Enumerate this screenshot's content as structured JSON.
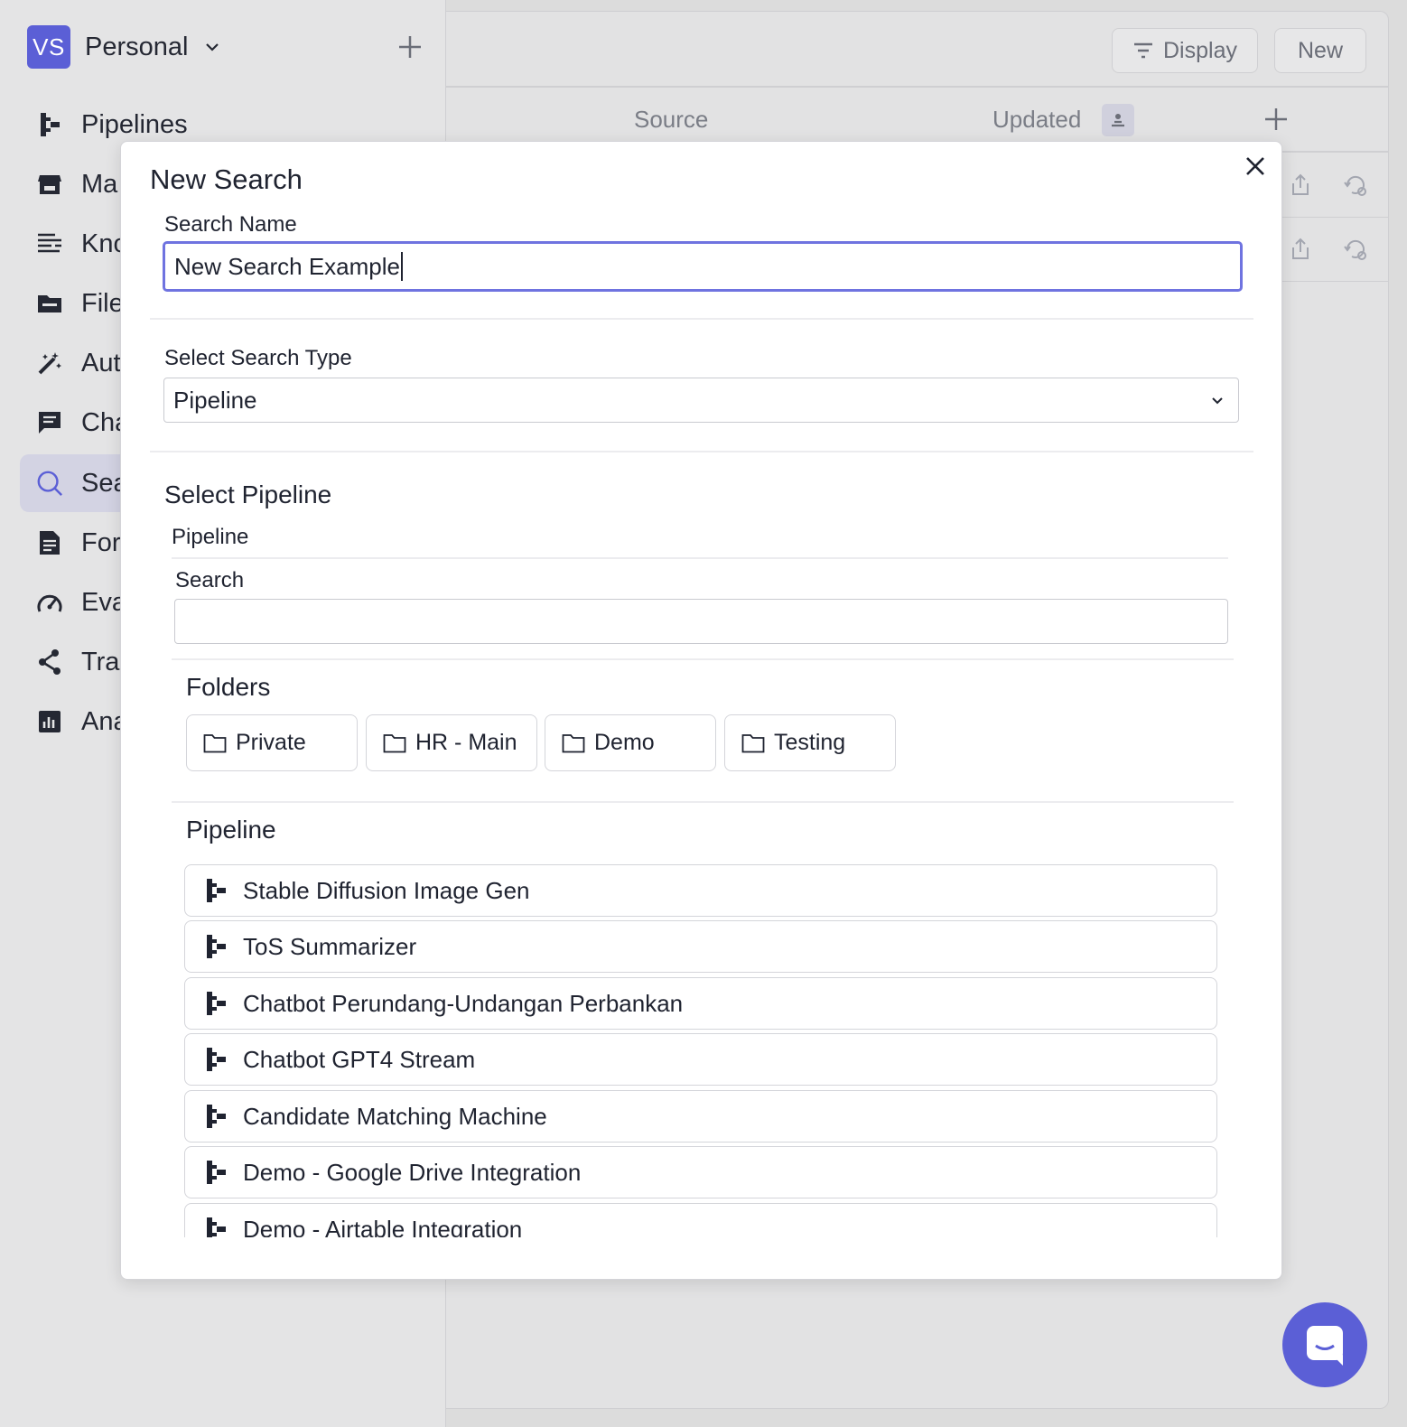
{
  "workspace": {
    "initials": "VS",
    "name": "Personal"
  },
  "sidebar": {
    "items": [
      {
        "label": "Pipelines",
        "icon": "pipeline-icon"
      },
      {
        "label": "Ma",
        "icon": "store-icon"
      },
      {
        "label": "Kno",
        "icon": "knowledge-icon"
      },
      {
        "label": "File",
        "icon": "folder-icon"
      },
      {
        "label": "Aut",
        "icon": "magic-wand-icon"
      },
      {
        "label": "Cha",
        "icon": "chat-icon"
      },
      {
        "label": "Sea",
        "icon": "search-icon"
      },
      {
        "label": "For",
        "icon": "form-icon"
      },
      {
        "label": "Eva",
        "icon": "gauge-icon"
      },
      {
        "label": "Tra",
        "icon": "share-icon"
      },
      {
        "label": "Ana",
        "icon": "analytics-icon"
      }
    ]
  },
  "toolbar": {
    "display_label": "Display",
    "new_label": "New"
  },
  "table": {
    "columns": [
      "Source",
      "Updated"
    ]
  },
  "modal": {
    "title": "New Search",
    "search_name_label": "Search Name",
    "search_name_value": "New Search Example",
    "search_type_label": "Select Search Type",
    "search_type_value": "Pipeline",
    "select_pipeline_heading": "Select Pipeline",
    "pipeline_tab": "Pipeline",
    "search_label": "Search",
    "search_value": "",
    "folders_heading": "Folders",
    "folders": [
      "Private",
      "HR - Main",
      "Demo",
      "Testing"
    ],
    "pipeline_heading": "Pipeline",
    "pipelines": [
      "Stable Diffusion Image Gen",
      "ToS Summarizer",
      "Chatbot Perundang-Undangan Perbankan",
      "Chatbot GPT4 Stream",
      "Candidate Matching Machine",
      "Demo - Google Drive Integration",
      "Demo - Airtable Integration"
    ]
  },
  "colors": {
    "accent": "#5b5fd6",
    "focus_border": "#6f73e0",
    "active_nav": "#d3d3e3"
  }
}
